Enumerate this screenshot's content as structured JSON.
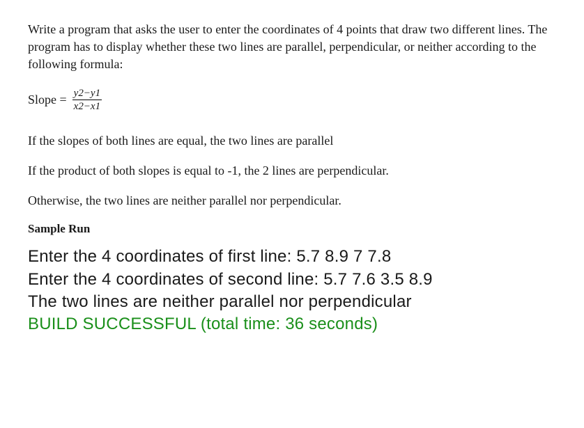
{
  "intro": "Write a program that asks the user to enter the coordinates of 4 points that draw two different lines. The program has to display whether these two lines are parallel, perpendicular, or neither according to the following formula:",
  "formula": {
    "label": "Slope =",
    "numerator": "y2−y1",
    "denominator": "x2−x1"
  },
  "rules": {
    "r1": "If the slopes of both lines are equal, the two lines are parallel",
    "r2": "If the product of both slopes is equal to -1, the 2 lines are perpendicular.",
    "r3": "Otherwise, the two lines are neither parallel nor perpendicular."
  },
  "sample_heading": "Sample Run",
  "output": {
    "line1": "Enter the 4 coordinates of first line: 5.7  8.9  7  7.8",
    "line2": "Enter the 4 coordinates of second line: 5.7 7.6 3.5 8.9",
    "line3": "The two lines are neither parallel nor perpendicular",
    "build": "BUILD SUCCESSFUL (total time: 36 seconds)"
  }
}
